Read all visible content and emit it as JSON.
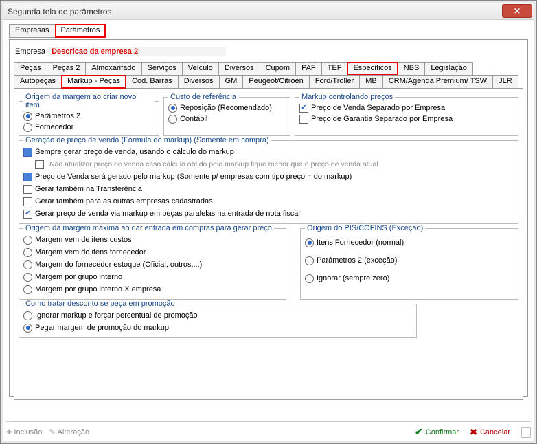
{
  "window": {
    "title": "Segunda tela de parâmetros"
  },
  "tabs_top": {
    "empresas": "Empresas",
    "parametros": "Parâmetros"
  },
  "empresa": {
    "label": "Empresa",
    "desc": "Descricao da empresa 2"
  },
  "tabs_sub1": {
    "pecas": "Peças",
    "pecas2": "Peças 2",
    "almox": "Almoxarifado",
    "servicos": "Serviços",
    "veiculo": "Veículo",
    "diversos": "Diversos",
    "cupom": "Cupom",
    "paf": "PAF",
    "tef": "TEF",
    "especificos": "Específicos",
    "nbs": "NBS",
    "legis": "Legislação"
  },
  "tabs_sub2": {
    "autopecas": "Autopeças",
    "markup": "Markup - Peças",
    "codbarras": "Cód. Barras",
    "diversos2": "Diversos",
    "gm": "GM",
    "peugeot": "Peugeot/Citroen",
    "ford": "Ford/Troller",
    "mb": "MB",
    "crm": "CRM/Agenda Premium/ TSW",
    "jlr": "JLR"
  },
  "origem_margem": {
    "legend": "Origem da margem ao criar novo item",
    "param2": "Parâmetros 2",
    "forn": "Fornecedor"
  },
  "custo_ref": {
    "legend": "Custo de referência",
    "repo": "Reposição (Recomendado)",
    "contabil": "Contábil"
  },
  "markup_ctrl": {
    "legend": "Markup controlando preços",
    "venda": "Preço de Venda Separado por Empresa",
    "garantia": "Preço de Garantia Separado por Empresa"
  },
  "geracao": {
    "legend": "Geração de preço de venda (Fórmula do markup) (Somente em compra)",
    "l1": "Sempre gerar preço de venda, usando o cálculo do markup",
    "l1_note": "Não atualizar preço de venda caso cálculo obtido pelo markup fique menor que o preço de venda atual",
    "l2": "Preço de Venda será gerado pelo markup (Somente p/ empresas com tipo preço = do markup)",
    "l3": "Gerar também na Transferência",
    "l4": "Gerar também para as outras empresas cadastradas",
    "l5": "Gerar preço de venda via markup em peças paralelas na entrada de nota fiscal"
  },
  "origem_max": {
    "legend": "Origem da margem máxima ao dar entrada em compras para gerar preço",
    "r1": "Margem vem de itens custos",
    "r2": "Margem vem do itens fornecedor",
    "r3": "Margem do fornecedor estoque (Oficial, outros,...)",
    "r4": "Margem por grupo interno",
    "r5": "Margem por grupo interno X empresa"
  },
  "pis": {
    "legend": "Origem do PIS/COFINS (Exceção)",
    "r1": "Itens Fornecedor (normal)",
    "r2": "Parâmetros 2 (exceção)",
    "r3": "Ignorar (sempre zero)"
  },
  "promo": {
    "legend": "Como tratar desconto se peça em promoção",
    "r1": "Ignorar markup e forçar percentual de promoção",
    "r2": "Pegar margem de promoção do markup"
  },
  "footer": {
    "inclusao": "Inclusão",
    "alteracao": "Alteração",
    "confirmar": "Confirmar",
    "cancelar": "Cancelar"
  }
}
